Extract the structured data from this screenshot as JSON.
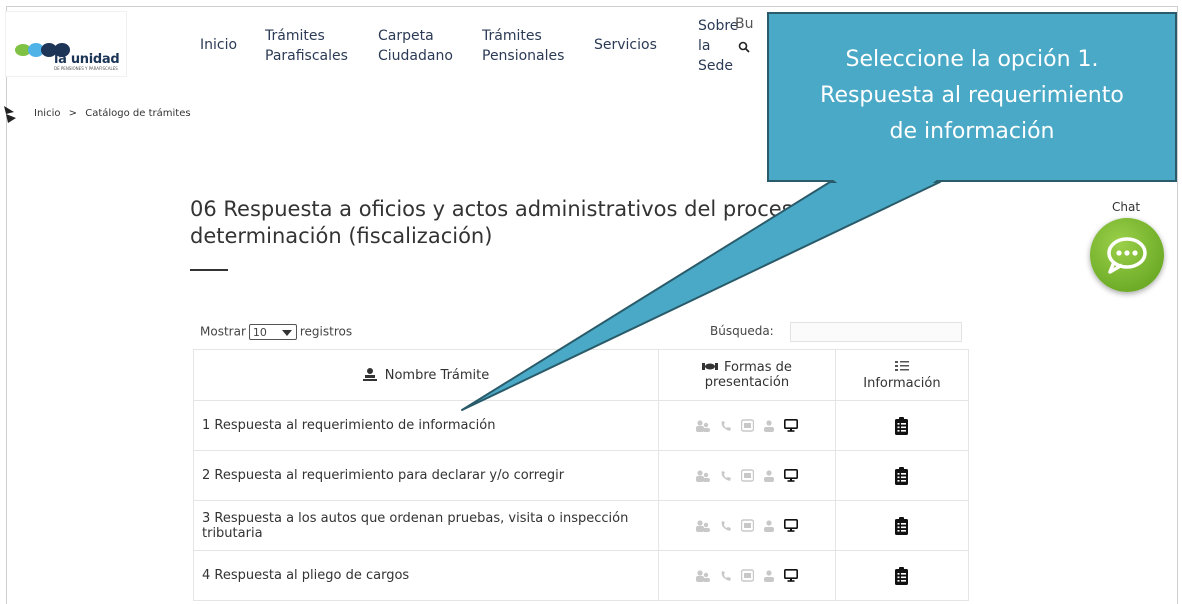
{
  "header": {
    "logo_text": "la unidad",
    "logo_sub": "DE PENSIONES Y PARAFISCALES",
    "nav": [
      {
        "line1": "Inicio",
        "line2": "",
        "line3": ""
      },
      {
        "line1": "Trámites",
        "line2": "Parafiscales",
        "line3": ""
      },
      {
        "line1": "Carpeta",
        "line2": "Ciudadano",
        "line3": ""
      },
      {
        "line1": "Trámites",
        "line2": "Pensionales",
        "line3": ""
      },
      {
        "line1": "Servicios",
        "line2": "",
        "line3": ""
      },
      {
        "line1": "Sobre",
        "line2": "la",
        "line3": "Sede"
      }
    ],
    "search_partial": "Bu"
  },
  "breadcrumb": {
    "home": "Inicio",
    "sep": ">",
    "current": "Catálogo de trámites"
  },
  "page": {
    "title": "06 Respuesta a oficios y actos administrativos del proceso de determinación (fiscalización)"
  },
  "table_controls": {
    "show_prefix": "Mostrar",
    "show_value": "10",
    "show_suffix": "registros",
    "search_label": "Búsqueda:"
  },
  "table": {
    "headers": {
      "name": "Nombre Trámite",
      "forms_line1": "Formas de",
      "forms_line2": "presentación",
      "info": "Información"
    },
    "rows": [
      {
        "name": "1 Respuesta al requerimiento de información"
      },
      {
        "name": "2 Respuesta al requerimiento para declarar y/o corregir"
      },
      {
        "name": "3 Respuesta a los autos que ordenan pruebas, visita o inspección tributaria"
      },
      {
        "name": "4 Respuesta al pliego de cargos"
      }
    ]
  },
  "chat": {
    "label": "Chat"
  },
  "callout": {
    "line1": "Seleccione la opción 1.",
    "line2": "Respuesta al requerimiento",
    "line3": "de información"
  },
  "colors": {
    "callout": "#4aa9c6",
    "callout_border": "#2a5b6a",
    "chat": "#7ab52f",
    "nav": "#2b3a55"
  }
}
